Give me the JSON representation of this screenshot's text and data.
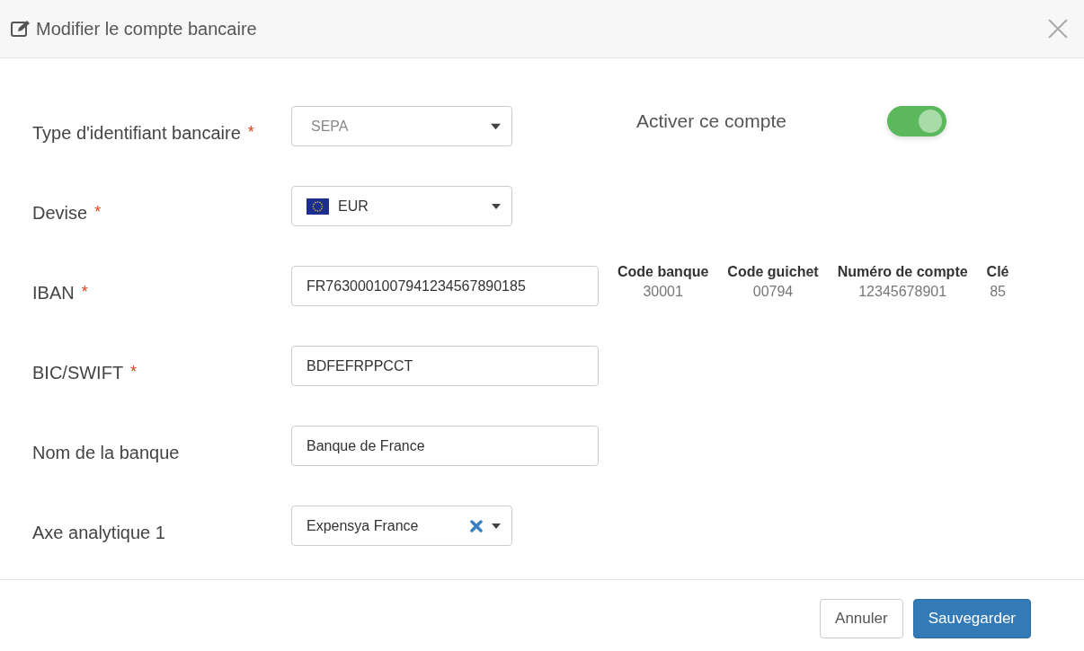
{
  "dialog": {
    "title": "Modifier le compte bancaire"
  },
  "fields": [
    {
      "kind": "select",
      "label": "Type d'identifiant bancaire",
      "required_mark": "*",
      "value": "SEPA",
      "disabled": true
    },
    {
      "kind": "currency",
      "label": "Devise",
      "required_mark": "*",
      "value": "EUR",
      "disabled": false
    },
    {
      "kind": "input",
      "label": "IBAN",
      "required_mark": "*",
      "value": "FR7630001007941234567890185",
      "disabled": false
    },
    {
      "kind": "input",
      "label": "BIC/SWIFT",
      "required_mark": "*",
      "value": "BDFEFRPPCCT",
      "disabled": false
    },
    {
      "kind": "input",
      "label": "Nom de la banque",
      "value": "Banque de France",
      "disabled": false
    },
    {
      "kind": "clearable",
      "label": "Axe analytique 1",
      "value": "Expensya France",
      "disabled": false
    }
  ],
  "toggle": {
    "label": "Activer ce compte",
    "on": true
  },
  "bank_details": [
    {
      "heading": "Code banque",
      "value": "30001"
    },
    {
      "heading": "Code guichet",
      "value": "00794"
    },
    {
      "heading": "Numéro de compte",
      "value": "12345678901"
    },
    {
      "heading": "Clé",
      "value": "85"
    }
  ],
  "buttons": [
    {
      "kind": "secondary",
      "label": "Annuler"
    },
    {
      "kind": "primary",
      "label": "Sauvegarder"
    }
  ]
}
